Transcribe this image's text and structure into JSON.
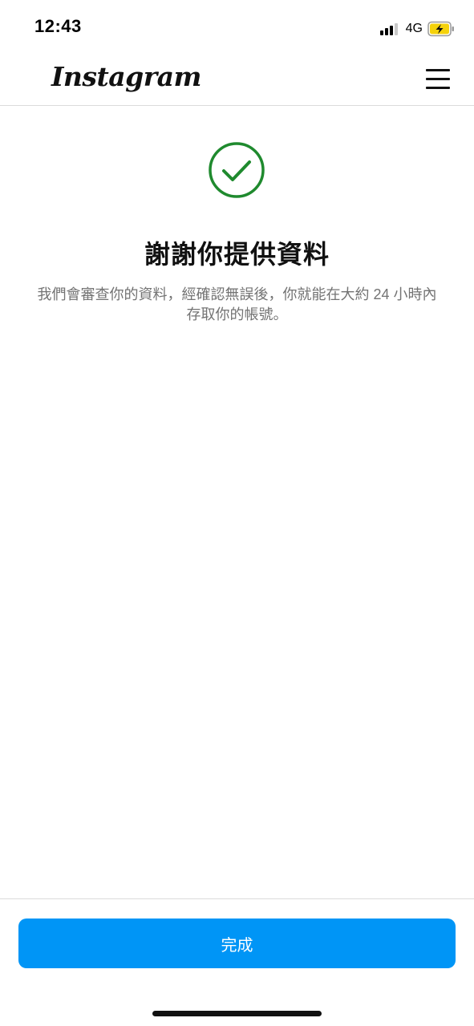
{
  "status_bar": {
    "time": "12:43",
    "network": "4G",
    "battery_color": "#f5d20b",
    "signal_bars": 3
  },
  "header": {
    "logo_text": "Instagram",
    "menu_icon": "hamburger-menu-icon"
  },
  "main": {
    "success_icon": "check-circle-icon",
    "success_color": "#1f8a2e",
    "title": "謝謝你提供資料",
    "description": "我們會審查你的資料，經確認無誤後，你就能在大約 24 小時內存取你的帳號。"
  },
  "footer": {
    "done_label": "完成",
    "button_color": "#0095f6"
  }
}
